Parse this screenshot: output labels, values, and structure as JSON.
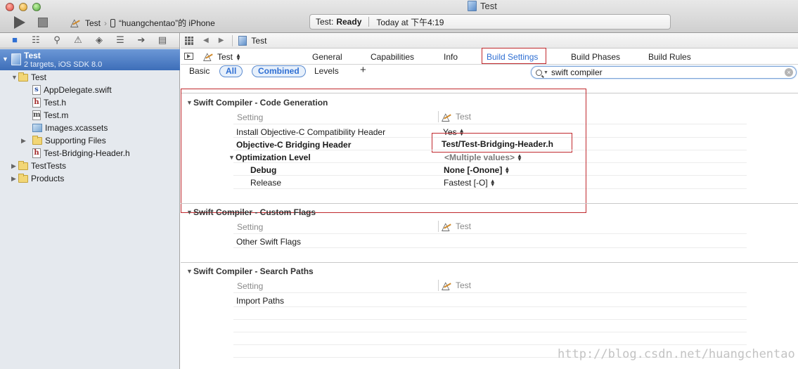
{
  "window": {
    "title": "Test"
  },
  "toolbar": {
    "scheme": "Test",
    "device": "“huangchentao”的 iPhone",
    "activity_prefix": "Test:",
    "activity_status": "Ready",
    "activity_time": "Today at 下午4:19"
  },
  "navigator": {
    "project": {
      "name": "Test",
      "subtitle": "2 targets, iOS SDK 8.0"
    },
    "items": [
      {
        "label": "Test"
      },
      {
        "label": "AppDelegate.swift"
      },
      {
        "label": "Test.h"
      },
      {
        "label": "Test.m"
      },
      {
        "label": "Images.xcassets"
      },
      {
        "label": "Supporting Files"
      },
      {
        "label": "Test-Bridging-Header.h"
      },
      {
        "label": "TestTests"
      },
      {
        "label": "Products"
      }
    ]
  },
  "jumpbar": {
    "crumb": "Test"
  },
  "editor": {
    "target": "Test",
    "tabs": [
      "General",
      "Capabilities",
      "Info",
      "Build Settings",
      "Build Phases",
      "Build Rules"
    ],
    "selected_tab": "Build Settings",
    "filters": {
      "basic": "Basic",
      "all": "All",
      "combined": "Combined",
      "levels": "Levels",
      "add": "+"
    },
    "search_value": "swift compiler"
  },
  "sections": [
    {
      "title": "Swift Compiler - Code Generation",
      "col_setting": "Setting",
      "col_target": "Test",
      "rows": [
        {
          "label": "Install Objective-C Compatibility Header",
          "value": "Yes"
        },
        {
          "label": "Objective-C Bridging Header",
          "value": "Test/Test-Bridging-Header.h"
        },
        {
          "label": "Optimization Level",
          "value": "<Multiple values>"
        },
        {
          "label": "Debug",
          "value": "None [-Onone]"
        },
        {
          "label": "Release",
          "value": "Fastest [-O]"
        }
      ]
    },
    {
      "title": "Swift Compiler - Custom Flags",
      "col_setting": "Setting",
      "col_target": "Test",
      "rows": [
        {
          "label": "Other Swift Flags",
          "value": ""
        }
      ]
    },
    {
      "title": "Swift Compiler - Search Paths",
      "col_setting": "Setting",
      "col_target": "Test",
      "rows": [
        {
          "label": "Import Paths",
          "value": ""
        }
      ]
    }
  ],
  "watermark": "http://blog.csdn.net/huangchentao",
  "colors": {
    "accent": "#2f6fd3",
    "highlight_box": "#c0282d",
    "selection": "#3d6eb9"
  }
}
